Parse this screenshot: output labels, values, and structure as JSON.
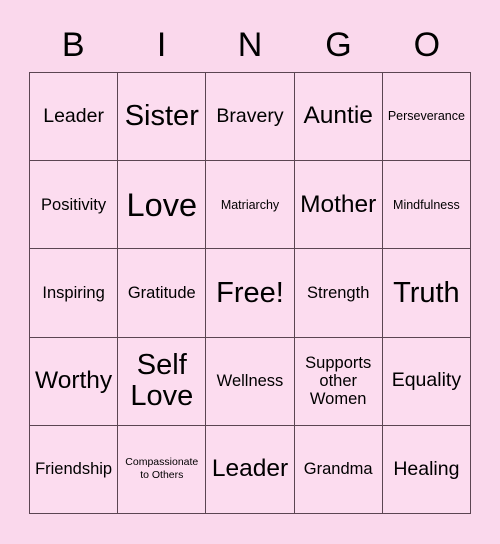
{
  "card": {
    "title": "BINGO",
    "background_color": "#fad8ec",
    "cell_color": "#fcdcef",
    "border_color": "#5b4552",
    "text_color": "#000000"
  },
  "header": {
    "letters": [
      "B",
      "I",
      "N",
      "G",
      "O"
    ]
  },
  "grid": {
    "columns": 5,
    "rows": 5,
    "cells": [
      {
        "text": "Leader",
        "size": "fs-l"
      },
      {
        "text": "Sister",
        "size": "fs-xxl"
      },
      {
        "text": "Bravery",
        "size": "fs-l"
      },
      {
        "text": "Auntie",
        "size": "fs-xl"
      },
      {
        "text": "Perseverance",
        "size": "fs-s"
      },
      {
        "text": "Positivity",
        "size": "fs-m"
      },
      {
        "text": "Love",
        "size": "fs-xxxl"
      },
      {
        "text": "Matriarchy",
        "size": "fs-s"
      },
      {
        "text": "Mother",
        "size": "fs-xl"
      },
      {
        "text": "Mindfulness",
        "size": "fs-s"
      },
      {
        "text": "Inspiring",
        "size": "fs-m"
      },
      {
        "text": "Gratitude",
        "size": "fs-m"
      },
      {
        "text": "Free!",
        "size": "fs-xxl"
      },
      {
        "text": "Strength",
        "size": "fs-m"
      },
      {
        "text": "Truth",
        "size": "fs-xxl"
      },
      {
        "text": "Worthy",
        "size": "fs-xl"
      },
      {
        "text": "Self\nLove",
        "size": "fs-xxl"
      },
      {
        "text": "Wellness",
        "size": "fs-m"
      },
      {
        "text": "Supports\nother\nWomen",
        "size": "fs-m"
      },
      {
        "text": "Equality",
        "size": "fs-l"
      },
      {
        "text": "Friendship",
        "size": "fs-m"
      },
      {
        "text": "Compassionate\nto Others",
        "size": "fs-xs"
      },
      {
        "text": "Leader",
        "size": "fs-xl"
      },
      {
        "text": "Grandma",
        "size": "fs-m"
      },
      {
        "text": "Healing",
        "size": "fs-l"
      }
    ]
  }
}
